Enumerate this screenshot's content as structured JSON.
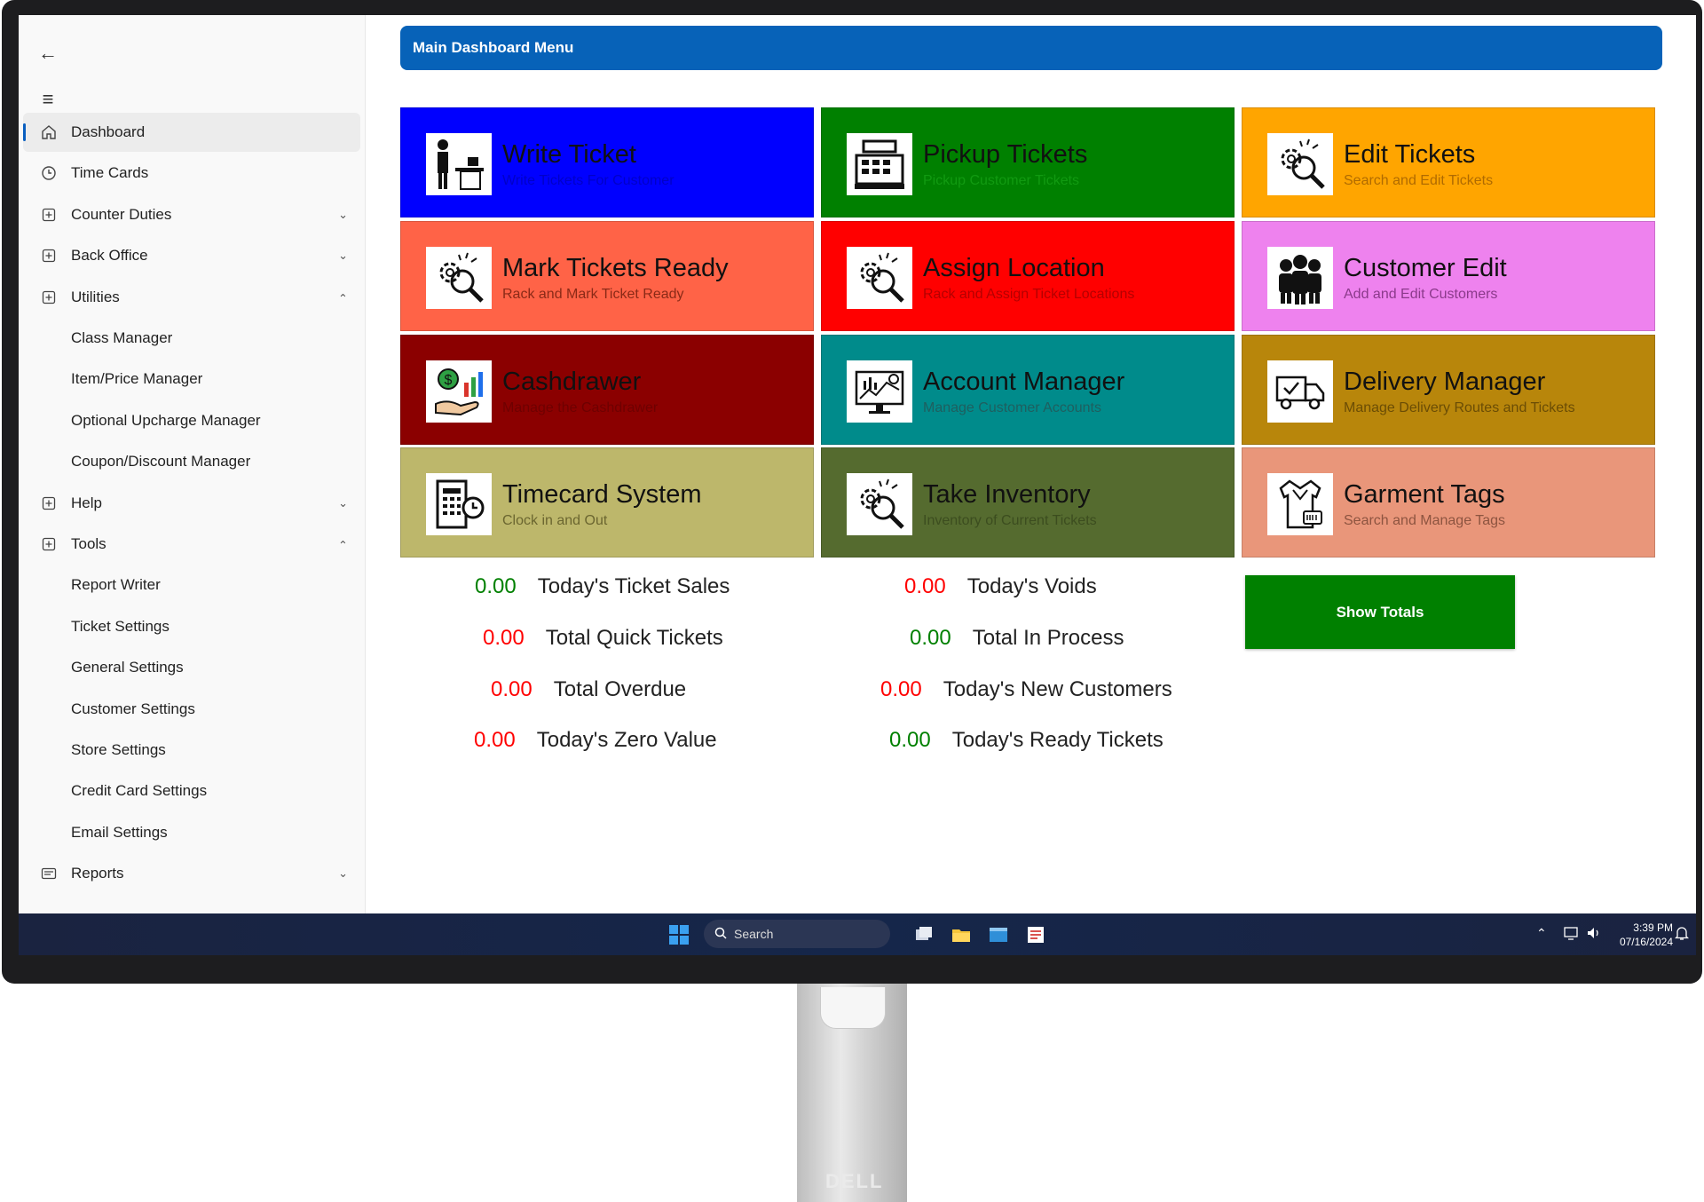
{
  "sidebar": {
    "back_icon": "arrow-left-icon",
    "menu_icon": "hamburger-icon",
    "items": [
      {
        "label": "Dashboard",
        "icon": "home-icon"
      },
      {
        "label": "Time Cards",
        "icon": "clock-icon"
      },
      {
        "label": "Counter Duties",
        "icon": "plus-box-icon"
      },
      {
        "label": "Back Office",
        "icon": "plus-box-icon"
      },
      {
        "label": "Utilities",
        "icon": "plus-box-icon"
      },
      {
        "label": "Class Manager"
      },
      {
        "label": "Item/Price Manager"
      },
      {
        "label": "Optional Upcharge Manager"
      },
      {
        "label": "Coupon/Discount Manager"
      },
      {
        "label": "Help",
        "icon": "plus-box-icon"
      },
      {
        "label": "Tools",
        "icon": "plus-box-icon"
      },
      {
        "label": "Report Writer"
      },
      {
        "label": "Ticket Settings"
      },
      {
        "label": "General Settings"
      },
      {
        "label": "Customer Settings"
      },
      {
        "label": "Store Settings"
      },
      {
        "label": "Credit Card Settings"
      },
      {
        "label": "Email Settings"
      },
      {
        "label": "Reports",
        "icon": "report-icon"
      }
    ]
  },
  "header": {
    "title": "Main Dashboard Menu"
  },
  "tiles": [
    {
      "title": "Write Ticket",
      "subtitle": "Write Tickets For Customer",
      "color": "#0000ff",
      "subcolor": "#0000c8",
      "icon": "person-counter-icon"
    },
    {
      "title": "Pickup Tickets",
      "subtitle": "Pickup Customer Tickets",
      "color": "#008000",
      "subcolor": "#119a11",
      "icon": "cash-register-icon"
    },
    {
      "title": "Edit Tickets",
      "subtitle": "Search and Edit Tickets",
      "color": "#ffa500",
      "subcolor": "#b06b00",
      "icon": "gear-search-icon"
    },
    {
      "title": "Mark Tickets Ready",
      "subtitle": "Rack and Mark Ticket Ready",
      "color": "#ff6347",
      "subcolor": "#8a2a17",
      "icon": "gear-search-icon"
    },
    {
      "title": "Assign Location",
      "subtitle": "Rack and Assign Ticket Locations",
      "color": "#ff0000",
      "subcolor": "#b40000",
      "icon": "gear-search-icon"
    },
    {
      "title": "Customer Edit",
      "subtitle": "Add and Edit Customers",
      "color": "#ee82ee",
      "subcolor": "#8b3a8b",
      "icon": "people-icon"
    },
    {
      "title": "Cashdrawer",
      "subtitle": "Manage the Cashdrawer",
      "color": "#8b0000",
      "subcolor": "#6e0000",
      "icon": "money-chart-icon"
    },
    {
      "title": "Account Manager",
      "subtitle": "Manage Customer Accounts",
      "color": "#008b8b",
      "subcolor": "#1e5f5f",
      "icon": "monitor-chart-icon"
    },
    {
      "title": "Delivery Manager",
      "subtitle": "Manage Delivery Routes and Tickets",
      "color": "#b8860b",
      "subcolor": "#6b4d05",
      "icon": "delivery-truck-icon"
    },
    {
      "title": "Timecard System",
      "subtitle": "Clock in and Out",
      "color": "#bdb76b",
      "subcolor": "#6b6630",
      "icon": "timecard-icon"
    },
    {
      "title": "Take Inventory",
      "subtitle": "Inventory of Current Tickets",
      "color": "#556b2f",
      "subcolor": "#3c4d1f",
      "icon": "gear-search-icon"
    },
    {
      "title": "Garment Tags",
      "subtitle": "Search and Manage Tags",
      "color": "#e9967a",
      "subcolor": "#8d5440",
      "icon": "garment-tag-icon"
    }
  ],
  "stats_left": [
    {
      "value": "0.00",
      "label": "Today's Ticket Sales",
      "color": "#008000"
    },
    {
      "value": "0.00",
      "label": "Total Quick Tickets",
      "color": "#ff0000"
    },
    {
      "value": "0.00",
      "label": "Total Overdue",
      "color": "#ff0000"
    },
    {
      "value": "0.00",
      "label": "Today's Zero Value",
      "color": "#ff0000"
    }
  ],
  "stats_right": [
    {
      "value": "0.00",
      "label": "Today's Voids",
      "color": "#ff0000"
    },
    {
      "value": "0.00",
      "label": "Total In Process",
      "color": "#008000"
    },
    {
      "value": "0.00",
      "label": "Today's New Customers",
      "color": "#ff0000"
    },
    {
      "value": "0.00",
      "label": "Today's Ready Tickets",
      "color": "#008000"
    }
  ],
  "show_totals_label": "Show Totals",
  "taskbar": {
    "search_placeholder": "Search",
    "time": "3:39 PM",
    "date": "07/16/2024"
  },
  "stand_logo": "DELL"
}
